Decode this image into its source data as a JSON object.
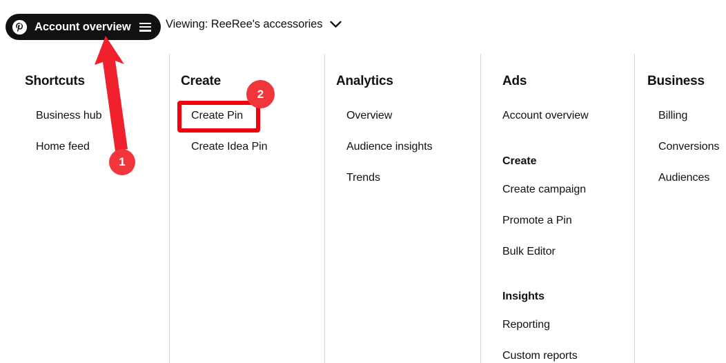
{
  "topbar": {
    "account_pill": {
      "logo_icon": "pinterest-logo-icon",
      "label": "Account overview",
      "menu_icon": "hamburger-menu-icon"
    },
    "viewing": {
      "label": "Viewing: ReeRee's accessories",
      "chevron_icon": "chevron-down-icon"
    }
  },
  "columns": [
    {
      "title": "Shortcuts",
      "items": [
        {
          "label": "Business hub",
          "type": "link"
        },
        {
          "label": "Home feed",
          "type": "link"
        }
      ]
    },
    {
      "title": "Create",
      "items": [
        {
          "label": "Create Pin",
          "type": "link"
        },
        {
          "label": "Create Idea Pin",
          "type": "link"
        }
      ]
    },
    {
      "title": "Analytics",
      "items": [
        {
          "label": "Overview",
          "type": "link"
        },
        {
          "label": "Audience insights",
          "type": "link"
        },
        {
          "label": "Trends",
          "type": "link"
        }
      ]
    },
    {
      "title": "Ads",
      "items": [
        {
          "label": "Account overview",
          "type": "link"
        },
        {
          "label": "Create",
          "type": "subhead"
        },
        {
          "label": "Create campaign",
          "type": "link"
        },
        {
          "label": "Promote a Pin",
          "type": "link"
        },
        {
          "label": "Bulk Editor",
          "type": "link"
        },
        {
          "label": "Insights",
          "type": "subhead"
        },
        {
          "label": "Reporting",
          "type": "link"
        },
        {
          "label": "Custom reports",
          "type": "link"
        }
      ]
    },
    {
      "title": "Business",
      "items": [
        {
          "label": "Billing",
          "type": "link"
        },
        {
          "label": "Conversions",
          "type": "link"
        },
        {
          "label": "Audiences",
          "type": "link"
        }
      ]
    }
  ],
  "annotations": {
    "arrow_color": "#f0212c",
    "badge_color": "#f0353b",
    "highlight_color": "#f2000c",
    "step_1": "1",
    "step_2": "2"
  }
}
